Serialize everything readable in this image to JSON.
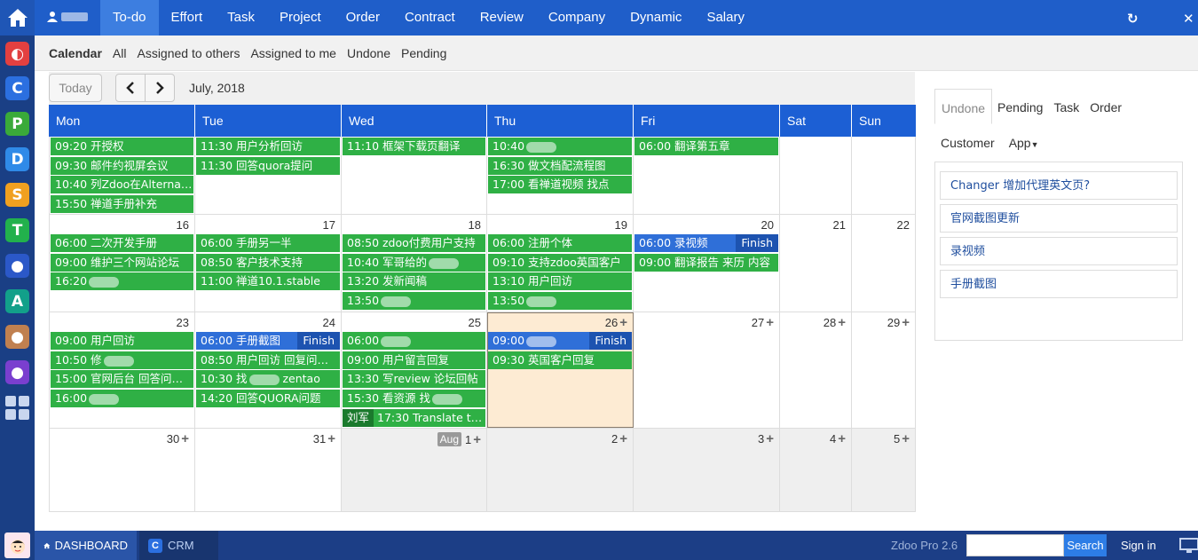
{
  "topnav": {
    "items": [
      "To-do",
      "Effort",
      "Task",
      "Project",
      "Order",
      "Contract",
      "Review",
      "Company",
      "Dynamic",
      "Salary"
    ]
  },
  "subnav": {
    "items": [
      "Calendar",
      "All",
      "Assigned to others",
      "Assigned to me",
      "Undone",
      "Pending"
    ]
  },
  "toolbar": {
    "today_label": "Today",
    "month_label": "July, 2018"
  },
  "calendar": {
    "weekdays": [
      "Mon",
      "Tue",
      "Wed",
      "Thu",
      "Fri",
      "Sat",
      "Sun"
    ],
    "finish_label": "Finish",
    "aug_label": "Aug",
    "week1": {
      "mon": [
        "09:20 开授权",
        "09:30 邮件约视屏会议",
        "10:40 列Zdoo在Alternati…",
        "15:50 禅道手册补充"
      ],
      "tue": [
        "11:30 用户分析回访",
        "11:30 回答quora提问"
      ],
      "wed": [
        "11:10 框架下载页翻译"
      ],
      "thu": [
        "10:40",
        "16:30 做文档配流程图",
        "17:00 看禅道视频 找点"
      ],
      "fri": [
        "06:00 翻译第五章"
      ]
    },
    "week2": {
      "days": [
        "16",
        "17",
        "18",
        "19",
        "20",
        "21",
        "22"
      ],
      "mon": [
        "06:00 二次开发手册",
        "09:00 维护三个网站论坛",
        "16:20"
      ],
      "tue": [
        "06:00 手册另一半",
        "08:50 客户技术支持",
        "11:00 禅道10.1.stable"
      ],
      "wed": [
        "08:50 zdoo付费用户支持",
        "10:40 军哥给的",
        "13:20 发新闻稿",
        "13:50"
      ],
      "thu": [
        "06:00 注册个体",
        "09:10 支持zdoo英国客户",
        "13:10 用户回访",
        "13:50"
      ],
      "fri": [
        "06:00 录视频",
        "09:00 翻译报告 来历 内容"
      ]
    },
    "week3": {
      "days": [
        "23",
        "24",
        "25",
        "26",
        "27",
        "28",
        "29"
      ],
      "mon": [
        "09:00 用户回访",
        "10:50 修",
        "15:00 官网后台 回答问…",
        "16:00"
      ],
      "tue": [
        "06:00 手册截图",
        "08:50 用户回访 回复问…",
        "10:30 找",
        "14:20 回答QUORA问题"
      ],
      "tue_extra": "zentao",
      "wed": [
        "06:00",
        "09:00 用户留言回复",
        "13:30 写review 论坛回帖",
        "15:30 看资源 找"
      ],
      "wed_owner": "刘军",
      "wed_owner_event": "17:30 Translate th…",
      "thu": [
        "09:00",
        "09:30 英国客户回复"
      ]
    },
    "week4": {
      "days": [
        "30",
        "31",
        "1",
        "2",
        "3",
        "4",
        "5"
      ]
    }
  },
  "rpanel": {
    "tabs": [
      "Undone",
      "Pending",
      "Task",
      "Order"
    ],
    "tabs2": [
      "Customer",
      "App"
    ],
    "items": [
      "Changer 增加代理英文页?",
      "官网截图更新",
      "录视频",
      "手册截图"
    ]
  },
  "taskbar": {
    "dashboard": "DASHBOARD",
    "crm": "CRM",
    "version": "Zdoo Pro 2.6",
    "search_label": "Search",
    "signin": "Sign in"
  },
  "colors": {
    "nav_blue": "#1f5ec9",
    "event_green": "#2fb045",
    "event_blue": "#2f6fd8",
    "today_bg": "#fdebd3"
  }
}
